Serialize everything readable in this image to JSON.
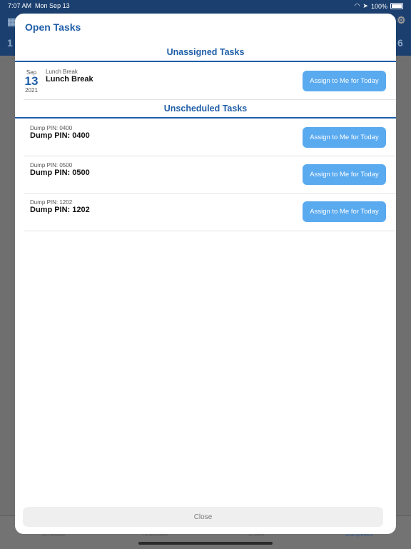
{
  "status_bar": {
    "time": "7:07 AM",
    "date": "Mon Sep 13",
    "battery": "100%"
  },
  "modal": {
    "title": "Open Tasks",
    "sections": {
      "unassigned": "Unassigned Tasks",
      "unscheduled": "Unscheduled Tasks"
    },
    "unassigned_tasks": [
      {
        "month": "Sep",
        "day": "13",
        "year": "2021",
        "subtitle": "Lunch Break",
        "title": "Lunch Break",
        "button": "Assign to Me for Today"
      }
    ],
    "unscheduled_tasks": [
      {
        "subtitle": "Dump PIN: 0400",
        "title": "Dump PIN: 0400",
        "button": "Assign to Me for Today"
      },
      {
        "subtitle": "Dump PIN: 0500",
        "title": "Dump PIN: 0500",
        "button": "Assign to Me for Today"
      },
      {
        "subtitle": "Dump PIN: 1202",
        "title": "Dump PIN: 1202",
        "button": "Assign to Me for Today"
      }
    ],
    "close_label": "Close"
  },
  "background_tabs": [
    "Schedule",
    "Timesheet",
    "Crews",
    "Dumpsters"
  ],
  "colors": {
    "accent": "#1f5ea8",
    "button": "#5aaaf0",
    "header": "#1b3f6e"
  }
}
